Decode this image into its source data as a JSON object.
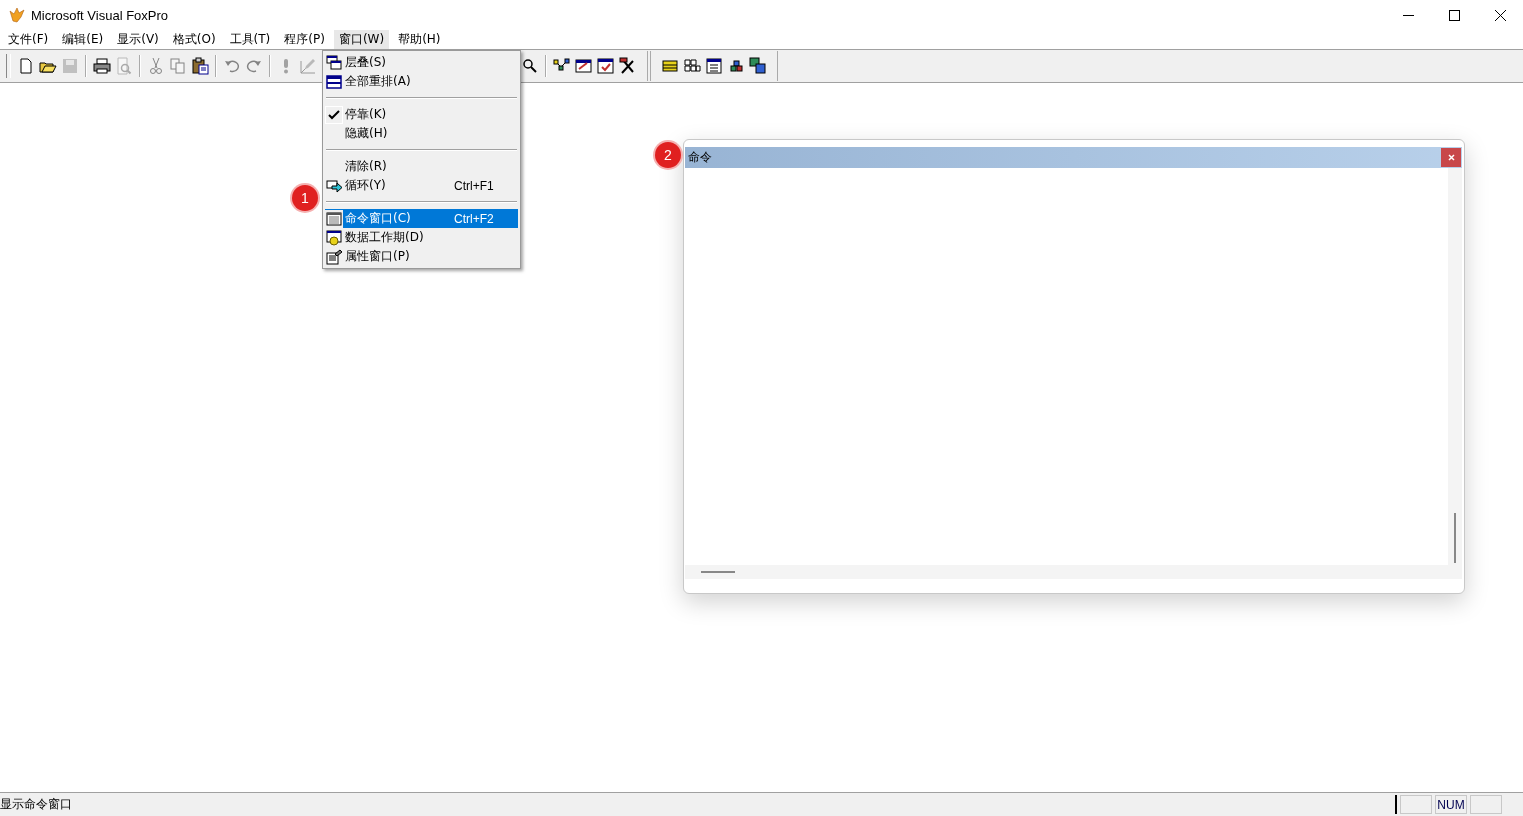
{
  "window": {
    "title": "Microsoft Visual FoxPro"
  },
  "menu_bar": [
    {
      "label": "文件(F)",
      "selected": false
    },
    {
      "label": "编辑(E)",
      "selected": false
    },
    {
      "label": "显示(V)",
      "selected": false
    },
    {
      "label": "格式(O)",
      "selected": false
    },
    {
      "label": "工具(T)",
      "selected": false
    },
    {
      "label": "程序(P)",
      "selected": false
    },
    {
      "label": "窗口(W)",
      "selected": true
    },
    {
      "label": "帮助(H)",
      "selected": false
    }
  ],
  "window_menu": [
    {
      "kind": "item",
      "label": "层叠(S)",
      "checked": false,
      "selected": false
    },
    {
      "kind": "item",
      "label": "全部重排(A)",
      "checked": false,
      "selected": false
    },
    {
      "kind": "separator"
    },
    {
      "kind": "item",
      "label": "停靠(K)",
      "checked": true,
      "selected": false
    },
    {
      "kind": "item",
      "label": "隐藏(H)",
      "checked": false,
      "selected": false
    },
    {
      "kind": "separator"
    },
    {
      "kind": "item",
      "label": "清除(R)",
      "checked": false,
      "selected": false
    },
    {
      "kind": "item",
      "label": "循环(Y)",
      "shortcut": "Ctrl+F1",
      "checked": false,
      "selected": false
    },
    {
      "kind": "separator"
    },
    {
      "kind": "item",
      "label": "命令窗口(C)",
      "shortcut": "Ctrl+F2",
      "checked": false,
      "selected": true
    },
    {
      "kind": "item",
      "label": "数据工作期(D)",
      "checked": false,
      "selected": false
    },
    {
      "kind": "item",
      "label": "属性窗口(P)",
      "checked": false,
      "selected": false
    }
  ],
  "command_window": {
    "title": "命令"
  },
  "callouts": [
    "1",
    "2"
  ],
  "status_bar": {
    "message": "显示命令窗口",
    "num_indicator": "NUM"
  }
}
